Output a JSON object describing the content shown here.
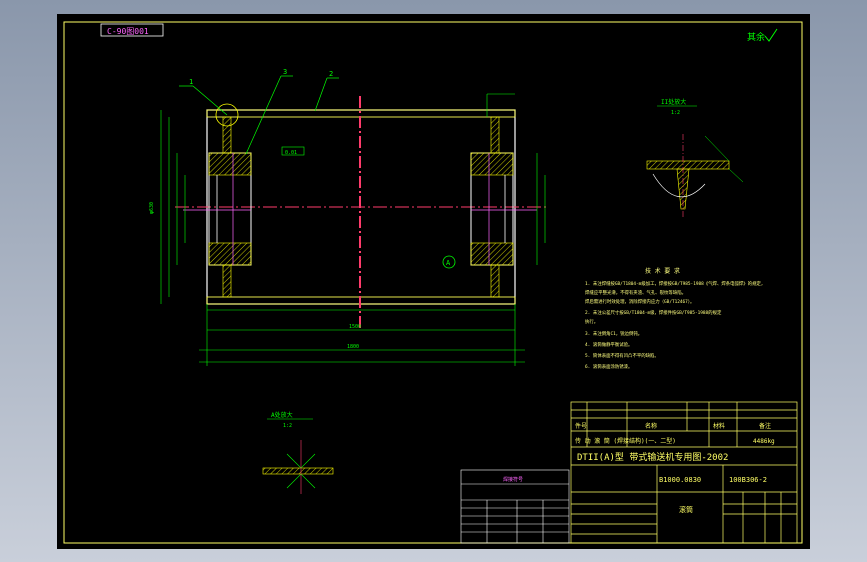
{
  "drawing": {
    "title_box": "C-90图001",
    "check_mark_text": "其余",
    "balloons": [
      "1",
      "3",
      "2"
    ],
    "detail_b_label": "B",
    "detail_circle_label": "A",
    "section_view_1": {
      "title": "II处放大",
      "scale": "1:2"
    },
    "section_view_2": {
      "title": "A处放大",
      "scale": "1:2"
    },
    "tolerance_box": "0.01",
    "dim_total_length": "1800",
    "dim_inner_length": "1500",
    "dim_diameter": "φ630",
    "notes_title": "技 术 要 求",
    "notes": [
      "1. 未注焊缝按GB/T1804-m级加工，焊接按GB/T985-1988《气焊、焊条电弧焊》的规定，",
      "   焊缝应平整光滑，不得有夹渣、气孔、裂纹等缺陷。",
      "   焊后需进行时效处理，消除焊接内应力（GB/T12467）。",
      "2. 未注公差尺寸按GB/T1804-m级，焊接件按GB/T985-1988的规定",
      "   执行。",
      "3. 未注倒角C1，锐边倒钝。",
      "4. 滚筒做静平衡试验。",
      "5. 筒体表面不得有凹凸不平的缺陷。",
      "6. 滚筒表面涂防锈漆。"
    ],
    "title_block": {
      "project": "DTII(A)型 带式输送机专用图-2002",
      "drawing_no_1": "B1000.0830",
      "drawing_no_2": "100B306-2",
      "weight_label": "重量",
      "weight_value": "4486kg",
      "part_name": "滚筒",
      "material_row": "传 动 滚 筒 (焊接结构)(一、二型)",
      "headers": [
        "件号",
        "名称",
        "材料",
        "备注"
      ],
      "sub_label": "图号"
    },
    "small_table_title": "焊接符号"
  },
  "colors": {
    "frame": "#ffff66",
    "geometry": "#ffffff",
    "dims": "#00ff00",
    "center": "#ff3b6b",
    "hatch": "#ffff00",
    "text": "#ff66ff",
    "notes_text": "#ffff80"
  }
}
